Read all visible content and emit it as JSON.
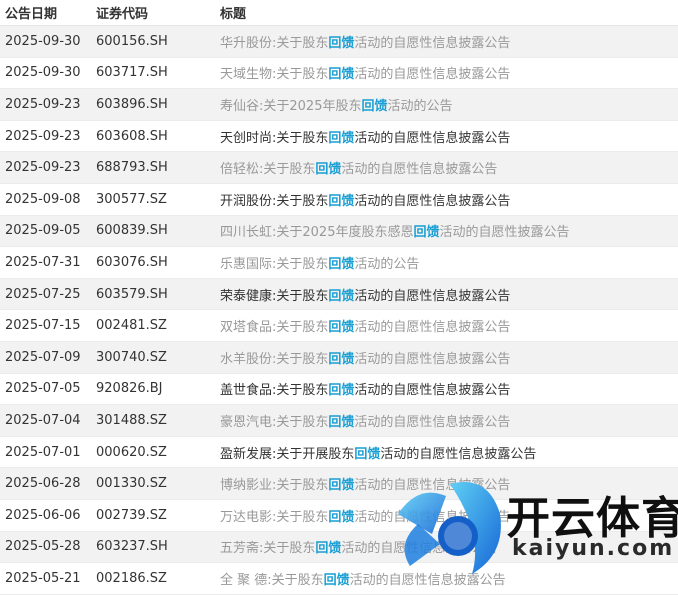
{
  "columns": {
    "date": "公告日期",
    "code": "证券代码",
    "title": "标题"
  },
  "rows": [
    {
      "date": "2025-09-30",
      "code": "600156.SH",
      "pre": "华升股份:关于股东",
      "hl": "回馈",
      "post": "活动的自愿性信息披露公告",
      "dark": false
    },
    {
      "date": "2025-09-30",
      "code": "603717.SH",
      "pre": "天域生物:关于股东",
      "hl": "回馈",
      "post": "活动的自愿性信息披露公告",
      "dark": false
    },
    {
      "date": "2025-09-23",
      "code": "603896.SH",
      "pre": "寿仙谷:关于2025年股东",
      "hl": "回馈",
      "post": "活动的公告",
      "dark": false
    },
    {
      "date": "2025-09-23",
      "code": "603608.SH",
      "pre": "天创时尚:关于股东",
      "hl": "回馈",
      "post": "活动的自愿性信息披露公告",
      "dark": true
    },
    {
      "date": "2025-09-23",
      "code": "688793.SH",
      "pre": "倍轻松:关于股东",
      "hl": "回馈",
      "post": "活动的自愿性信息披露公告",
      "dark": false
    },
    {
      "date": "2025-09-08",
      "code": "300577.SZ",
      "pre": "开润股份:关于股东",
      "hl": "回馈",
      "post": "活动的自愿性信息披露公告",
      "dark": true
    },
    {
      "date": "2025-09-05",
      "code": "600839.SH",
      "pre": "四川长虹:关于2025年度股东感恩",
      "hl": "回馈",
      "post": "活动的自愿性披露公告",
      "dark": false
    },
    {
      "date": "2025-07-31",
      "code": "603076.SH",
      "pre": "乐惠国际:关于股东",
      "hl": "回馈",
      "post": "活动的公告",
      "dark": false
    },
    {
      "date": "2025-07-25",
      "code": "603579.SH",
      "pre": "荣泰健康:关于股东",
      "hl": "回馈",
      "post": "活动的自愿性信息披露公告",
      "dark": true
    },
    {
      "date": "2025-07-15",
      "code": "002481.SZ",
      "pre": "双塔食品:关于股东",
      "hl": "回馈",
      "post": "活动的自愿性信息披露公告",
      "dark": false
    },
    {
      "date": "2025-07-09",
      "code": "300740.SZ",
      "pre": "水羊股份:关于股东",
      "hl": "回馈",
      "post": "活动的自愿性信息披露公告",
      "dark": false
    },
    {
      "date": "2025-07-05",
      "code": "920826.BJ",
      "pre": "盖世食品:关于股东",
      "hl": "回馈",
      "post": "活动的自愿性信息披露公告",
      "dark": true
    },
    {
      "date": "2025-07-04",
      "code": "301488.SZ",
      "pre": "豪恩汽电:关于股东",
      "hl": "回馈",
      "post": "活动的自愿性信息披露公告",
      "dark": false
    },
    {
      "date": "2025-07-01",
      "code": "000620.SZ",
      "pre": "盈新发展:关于开展股东",
      "hl": "回馈",
      "post": "活动的自愿性信息披露公告",
      "dark": true
    },
    {
      "date": "2025-06-28",
      "code": "001330.SZ",
      "pre": "博纳影业:关于股东",
      "hl": "回馈",
      "post": "活动的自愿性信息披露公告",
      "dark": false
    },
    {
      "date": "2025-06-06",
      "code": "002739.SZ",
      "pre": "万达电影:关于股东",
      "hl": "回馈",
      "post": "活动的自愿性信息披露公告",
      "dark": false
    },
    {
      "date": "2025-05-28",
      "code": "603237.SH",
      "pre": "五芳斋:关于股东",
      "hl": "回馈",
      "post": "活动的自愿性信息披露公告",
      "dark": false
    },
    {
      "date": "2025-05-21",
      "code": "002186.SZ",
      "pre": "全 聚 德:关于股东",
      "hl": "回馈",
      "post": "活动的自愿性信息披露公告",
      "dark": false
    }
  ],
  "watermark": {
    "brand": "开云体育",
    "url": "kaiyun.com"
  },
  "colors": {
    "highlight": "#1a9fd4",
    "stripe": "#f2f2f2",
    "muted_text": "#999999",
    "dark_text": "#333333"
  }
}
